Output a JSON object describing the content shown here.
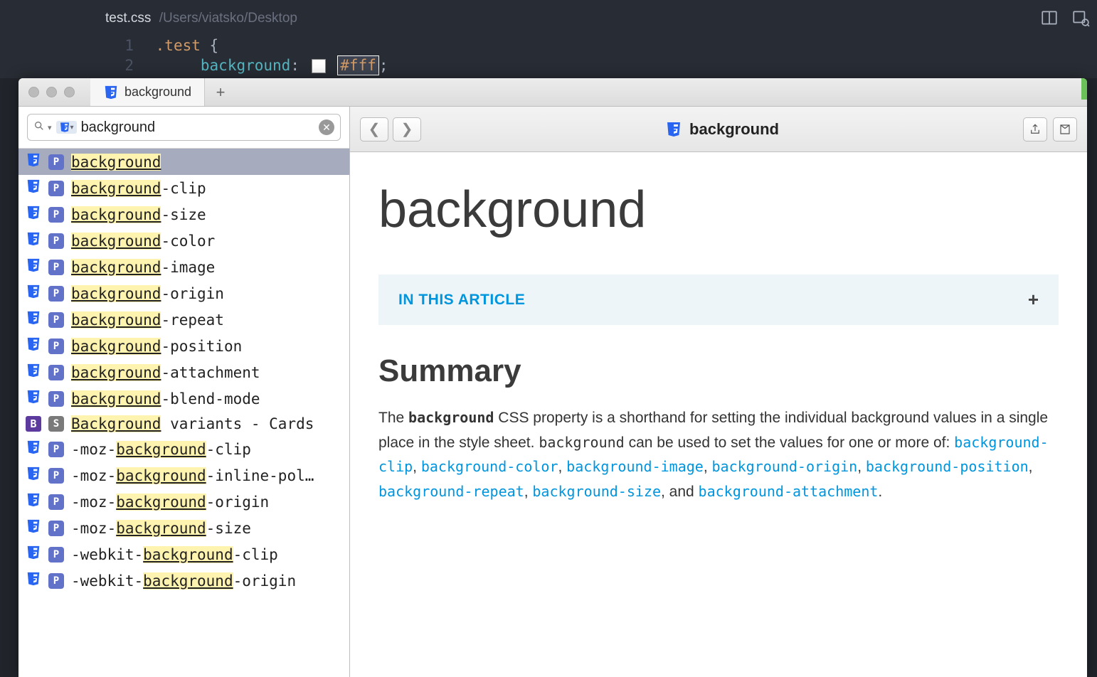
{
  "editor": {
    "filename": "test.css",
    "filepath": "/Users/viatsko/Desktop",
    "lines": {
      "1": {
        "num": "1",
        "selector": ".test",
        "brace_open": "{"
      },
      "2": {
        "num": "2",
        "prop": "background",
        "value": "#fff"
      }
    }
  },
  "dash": {
    "tab_title": "background",
    "search": {
      "value": "background"
    },
    "results": [
      {
        "type": "P",
        "text": "background",
        "match": "background",
        "suffix": "",
        "selected": true,
        "src": "css"
      },
      {
        "type": "P",
        "text": "background-clip",
        "match": "background",
        "suffix": "-clip",
        "src": "css"
      },
      {
        "type": "P",
        "text": "background-size",
        "match": "background",
        "suffix": "-size",
        "src": "css"
      },
      {
        "type": "P",
        "text": "background-color",
        "match": "background",
        "suffix": "-color",
        "src": "css"
      },
      {
        "type": "P",
        "text": "background-image",
        "match": "background",
        "suffix": "-image",
        "src": "css"
      },
      {
        "type": "P",
        "text": "background-origin",
        "match": "background",
        "suffix": "-origin",
        "src": "css"
      },
      {
        "type": "P",
        "text": "background-repeat",
        "match": "background",
        "suffix": "-repeat",
        "src": "css"
      },
      {
        "type": "P",
        "text": "background-position",
        "match": "background",
        "suffix": "-position",
        "src": "css"
      },
      {
        "type": "P",
        "text": "background-attachment",
        "match": "background",
        "suffix": "-attachment",
        "src": "css"
      },
      {
        "type": "P",
        "text": "background-blend-mode",
        "match": "background",
        "suffix": "-blend-mode",
        "src": "css"
      },
      {
        "type": "S",
        "text": "Background variants - Cards",
        "match": "Background",
        "suffix": " variants - Cards",
        "src": "bootstrap"
      },
      {
        "type": "P",
        "text": "-moz-background-clip",
        "prefix": "-moz-",
        "match": "background",
        "suffix": "-clip",
        "src": "css"
      },
      {
        "type": "P",
        "text": "-moz-background-inline-pol…",
        "prefix": "-moz-",
        "match": "background",
        "suffix": "-inline-pol…",
        "src": "css"
      },
      {
        "type": "P",
        "text": "-moz-background-origin",
        "prefix": "-moz-",
        "match": "background",
        "suffix": "-origin",
        "src": "css"
      },
      {
        "type": "P",
        "text": "-moz-background-size",
        "prefix": "-moz-",
        "match": "background",
        "suffix": "-size",
        "src": "css"
      },
      {
        "type": "P",
        "text": "-webkit-background-clip",
        "prefix": "-webkit-",
        "match": "background",
        "suffix": "-clip",
        "src": "css"
      },
      {
        "type": "P",
        "text": "-webkit-background-origin",
        "prefix": "-webkit-",
        "match": "background",
        "suffix": "-origin",
        "src": "css"
      }
    ],
    "doc": {
      "title_bar": "background",
      "h1": "background",
      "in_article": "IN THIS ARTICLE",
      "h2": "Summary",
      "summary_pre": "The ",
      "summary_kw": "background",
      "summary_mid1": " CSS property is a shorthand for setting the individual background values in a single place in the style sheet. ",
      "summary_kw2": "background",
      "summary_mid2": " can be used to set the values for one or more of: ",
      "links": [
        "background-clip",
        "background-color",
        "background-image",
        "background-origin",
        "background-position",
        "background-repeat",
        "background-size"
      ],
      "and": ", and ",
      "last_link": "background-attachment",
      "period": "."
    }
  }
}
